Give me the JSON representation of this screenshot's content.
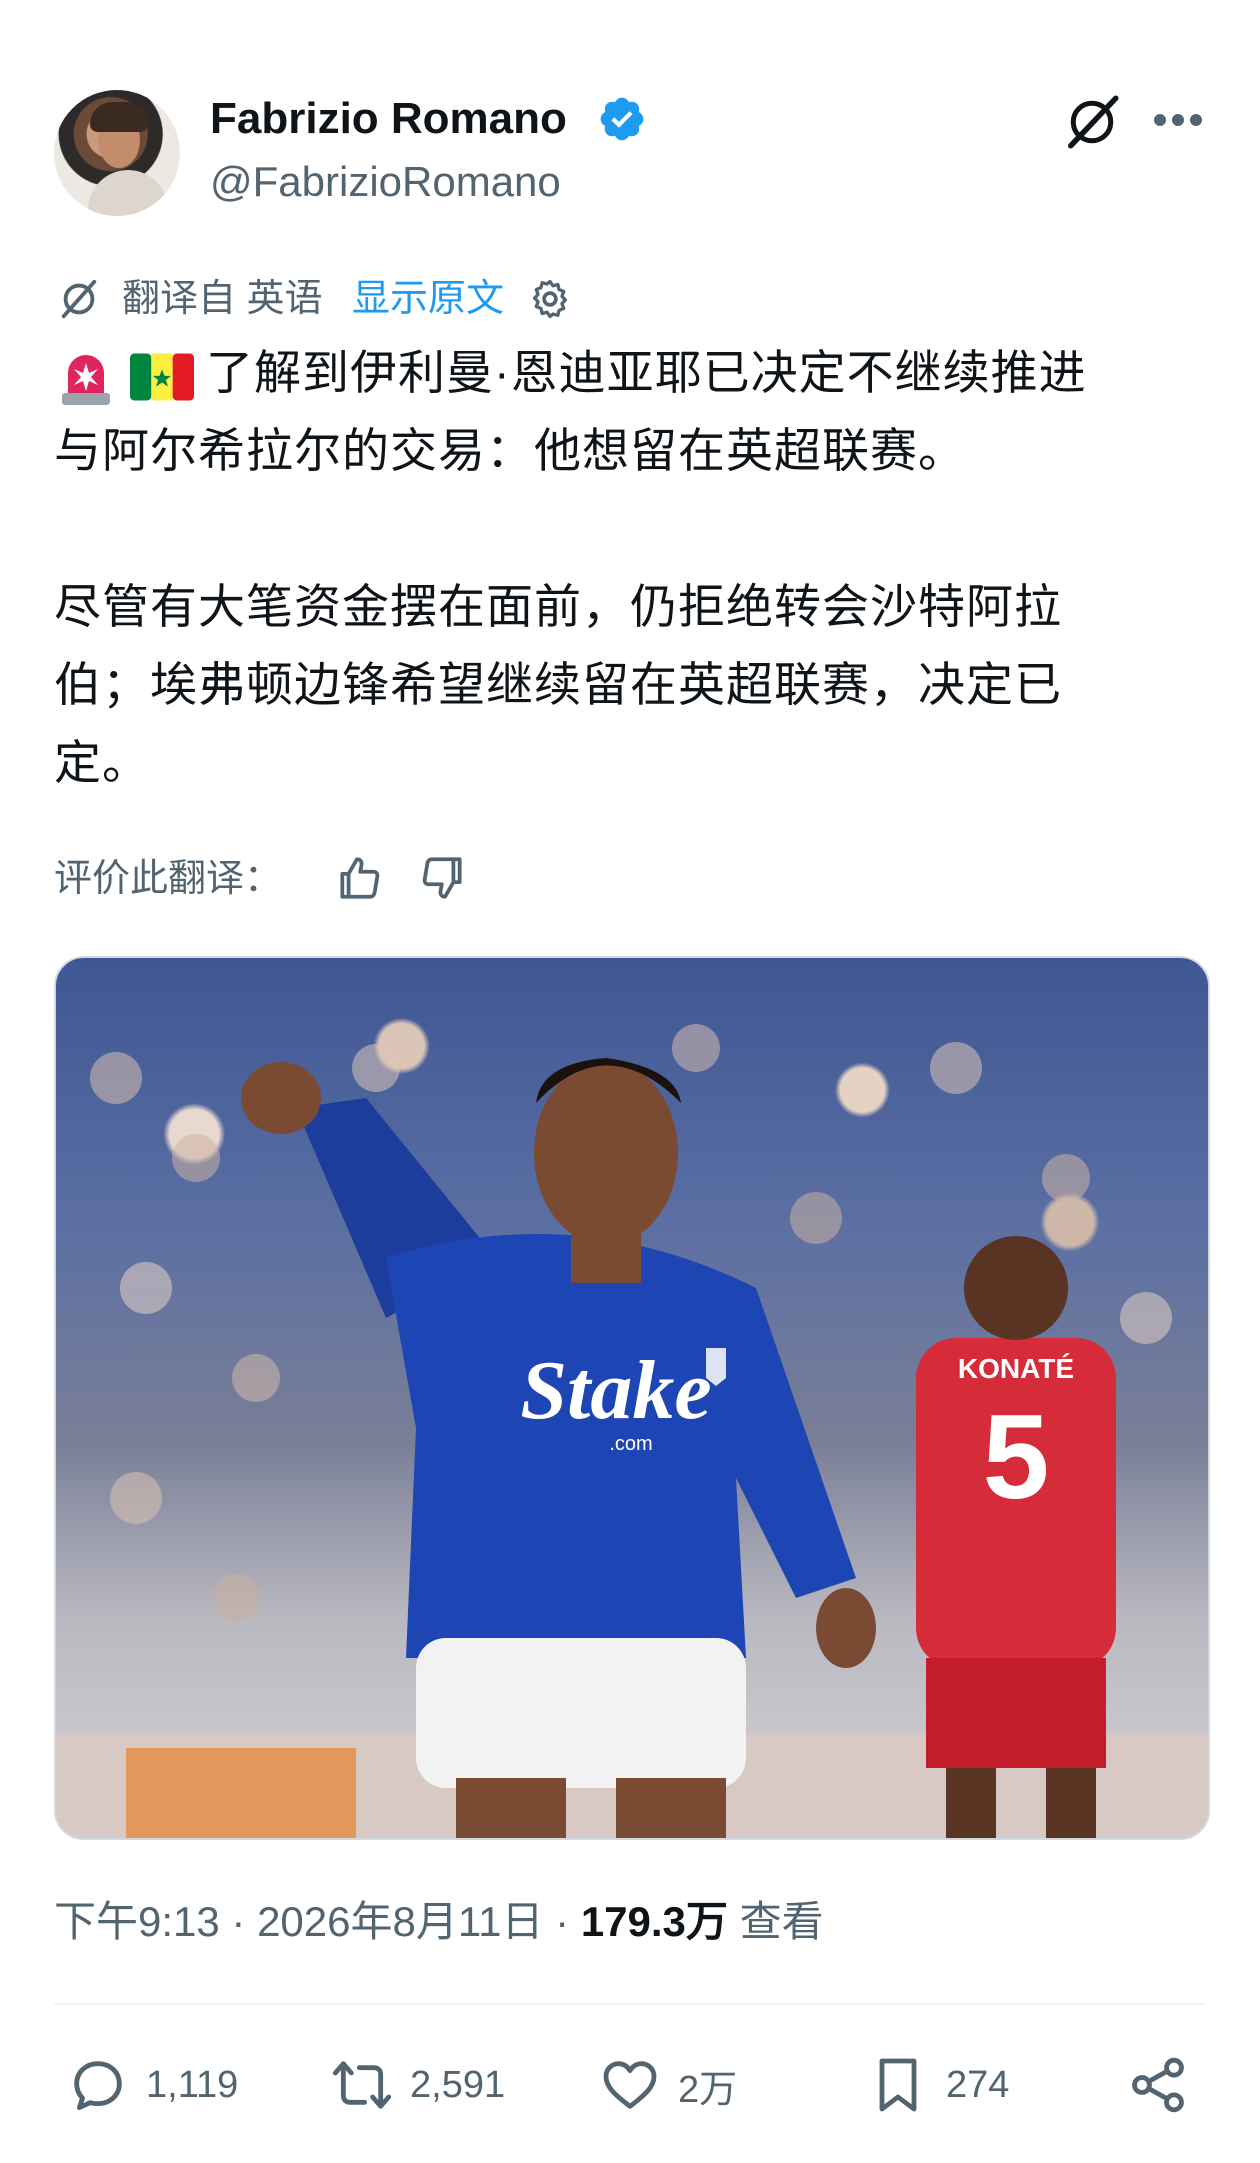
{
  "author": {
    "name": "Fabrizio Romano",
    "handle": "@FabrizioRomano",
    "verified": true,
    "avatar_icon": "avatar-photo"
  },
  "header_icons": [
    "grok-icon",
    "more-icon"
  ],
  "translation": {
    "label": "翻译自 英语",
    "show_original": "显示原文",
    "icon": "translate-icon",
    "settings_icon": "gear-icon"
  },
  "tweet": {
    "line1": "了解到伊利曼·恩迪亚耶已决定不继续推进",
    "line2": "与阿尔希拉尔的交易：他想留在英超联赛。",
    "para2_line1": "尽管有大笔资金摆在面前，仍拒绝转会沙特阿拉",
    "para2_line2": "伯；埃弗顿边锋希望继续留在英超联赛，决定已",
    "para2_line3": "定。",
    "emojis": [
      "siren-emoji",
      "senegal-flag-emoji"
    ]
  },
  "rate": {
    "label": "评价此翻译："
  },
  "media": {
    "description_icon": "player-photo",
    "jersey_text": "Stake",
    "jersey_sub": ".com",
    "opponent_number": "5",
    "opponent_name": "KONATÉ"
  },
  "meta": {
    "time": "下午9:13",
    "date": "2026年8月11日",
    "views": "179.3万",
    "views_label": "查看"
  },
  "actions": {
    "replies": "1,119",
    "retweets": "2,591",
    "likes": "2万",
    "bookmarks": "274"
  },
  "colors": {
    "accent": "#1d9bf0",
    "muted": "#536471",
    "text": "#0f1419"
  }
}
